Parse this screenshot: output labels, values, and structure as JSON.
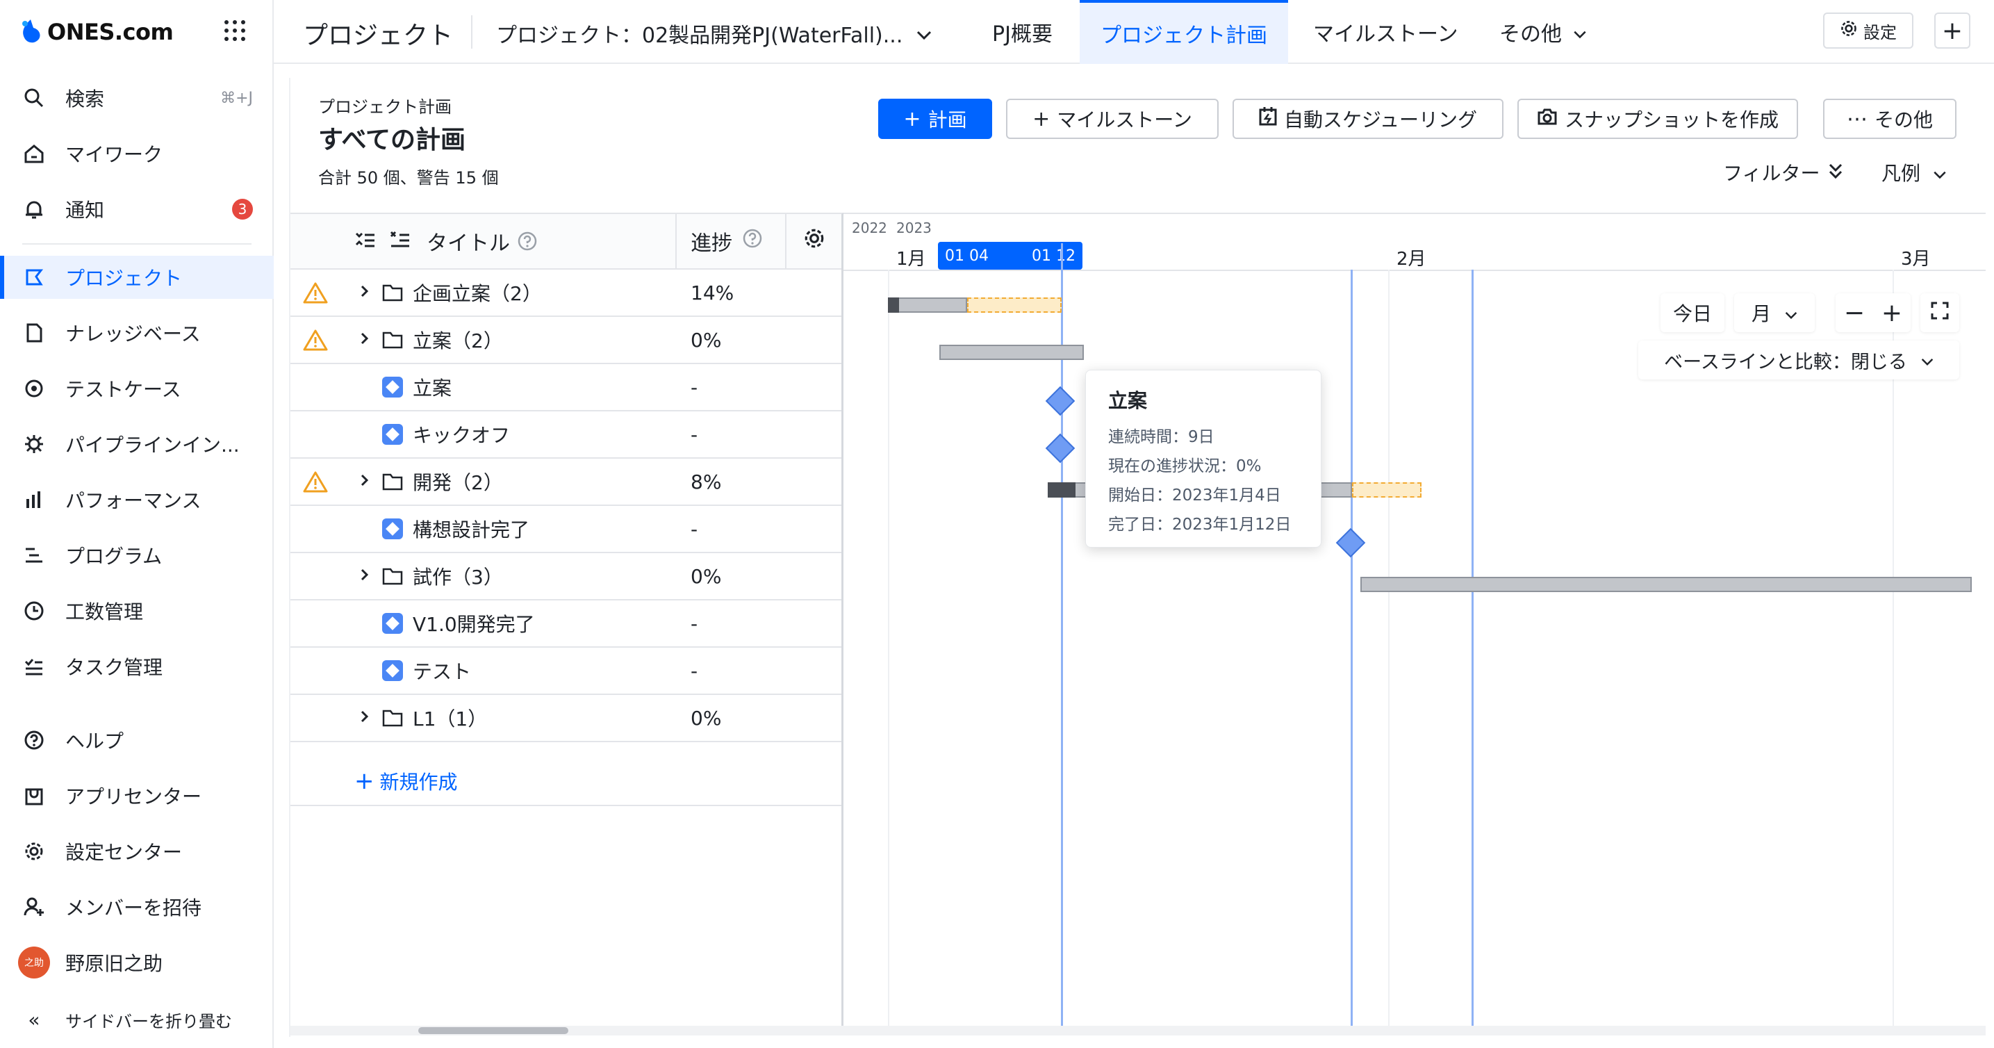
{
  "brand": {
    "name": "ONES.com"
  },
  "sidebar": {
    "items": [
      {
        "label": "検索",
        "shortcut": "⌘+J",
        "icon": "search-icon"
      },
      {
        "label": "マイワーク",
        "icon": "home-icon"
      },
      {
        "label": "通知",
        "badge": "3",
        "icon": "bell-icon"
      },
      {
        "label": "プロジェクト",
        "icon": "project-icon",
        "active": true
      },
      {
        "label": "ナレッジベース",
        "icon": "document-icon"
      },
      {
        "label": "テストケース",
        "icon": "testcase-icon"
      },
      {
        "label": "パイプラインイン...",
        "icon": "pipeline-icon"
      },
      {
        "label": "パフォーマンス",
        "icon": "bar-chart-icon"
      },
      {
        "label": "プログラム",
        "icon": "program-icon"
      },
      {
        "label": "工数管理",
        "icon": "clock-icon"
      },
      {
        "label": "タスク管理",
        "icon": "task-icon"
      },
      {
        "label": "ヘルプ",
        "icon": "help-icon"
      },
      {
        "label": "アプリセンター",
        "icon": "app-center-icon"
      },
      {
        "label": "設定センター",
        "icon": "gear-icon"
      },
      {
        "label": "メンバーを招待",
        "icon": "add-user-icon"
      }
    ],
    "user": {
      "name": "野原旧之助",
      "avatar_text": "之助"
    },
    "collapse_label": "サイドバーを折り畳む"
  },
  "topbar": {
    "title": "プロジェクト",
    "project_select": "プロジェクト：02製品開発PJ(WaterFall)...",
    "tabs": [
      "PJ概要",
      "プロジェクト計画",
      "マイルストーン",
      "その他"
    ],
    "active_tab": "プロジェクト計画",
    "settings_label": "設定",
    "add_label": "+"
  },
  "header": {
    "breadcrumb": "プロジェクト計画",
    "title": "すべての計画",
    "summary": "合計 50 個、警告 15 個",
    "buttons": {
      "plan": "計画",
      "milestone": "マイルストーン",
      "auto_schedule": "自動スケジューリング",
      "snapshot": "スナップショットを作成",
      "more": "その他"
    },
    "filter_label": "フィルター",
    "legend_label": "凡例"
  },
  "table": {
    "columns": {
      "title": "タイトル",
      "progress": "進捗"
    },
    "rows": [
      {
        "title": "企画立案（2）",
        "progress": "14%",
        "type": "folder",
        "warning": true,
        "expandable": true
      },
      {
        "title": "立案（2）",
        "progress": "0%",
        "type": "folder",
        "warning": true,
        "expandable": true
      },
      {
        "title": "立案",
        "progress": "-",
        "type": "milestone",
        "warning": false,
        "expandable": false
      },
      {
        "title": "キックオフ",
        "progress": "-",
        "type": "milestone",
        "warning": false,
        "expandable": false
      },
      {
        "title": "開発（2）",
        "progress": "8%",
        "type": "folder",
        "warning": true,
        "expandable": true
      },
      {
        "title": "構想設計完了",
        "progress": "-",
        "type": "milestone",
        "warning": false,
        "expandable": false
      },
      {
        "title": "試作（3）",
        "progress": "0%",
        "type": "folder",
        "warning": false,
        "expandable": true
      },
      {
        "title": "V1.0開発完了",
        "progress": "-",
        "type": "milestone",
        "warning": false,
        "expandable": false
      },
      {
        "title": "テスト",
        "progress": "-",
        "type": "milestone",
        "warning": false,
        "expandable": false
      },
      {
        "title": "L1（1）",
        "progress": "0%",
        "type": "folder",
        "warning": false,
        "expandable": true
      }
    ],
    "new_label": "新規作成"
  },
  "gantt": {
    "years": [
      "2022",
      "2023"
    ],
    "months": [
      "1月",
      "2月",
      "3月"
    ],
    "range_start": "01 04",
    "range_end": "01 12",
    "controls": {
      "today": "今日",
      "scale": "月",
      "baseline": "ベースラインと比較：閉じる"
    },
    "tooltip": {
      "title": "立案",
      "duration": "連続時間：9日",
      "progress": "現在の進捗状況：0%",
      "start": "開始日：2023年1月4日",
      "end": "完了日：2023年1月12日"
    }
  },
  "colors": {
    "accent": "#0064ff",
    "warning": "#f0a020",
    "badge": "#e5483f",
    "milestone": "#6f9cf4"
  }
}
